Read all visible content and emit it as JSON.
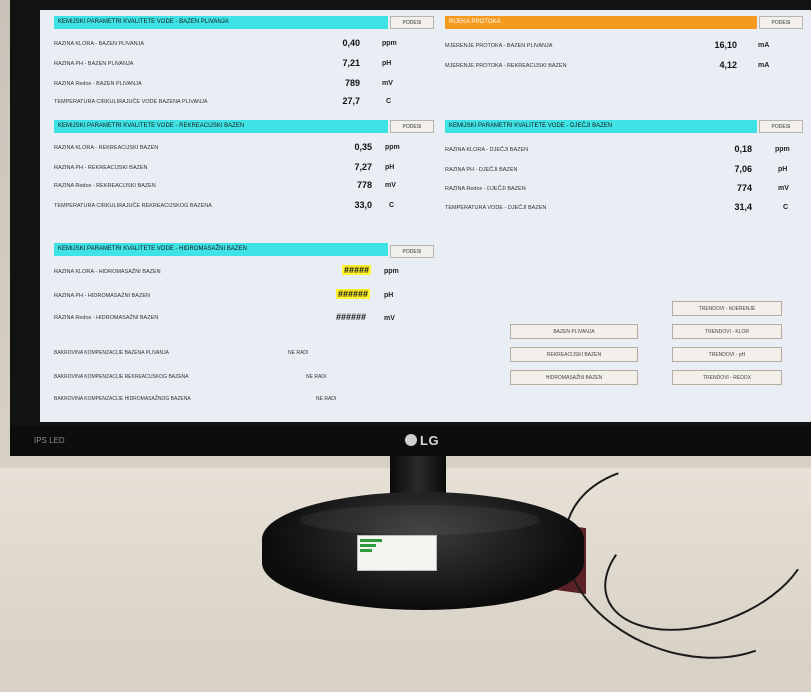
{
  "monitor": {
    "brand": "LG",
    "corner_text": "IPS LED"
  },
  "panel_plivanja": {
    "title": "KEMIJSKI PARAMETRI KVALITETE VODE - BAZEN PLIVANJA",
    "button": "PODESI",
    "rows": [
      {
        "label": "RAZINA KLORA - BAZEN PLIVANJA",
        "value": "0,40",
        "unit": "ppm"
      },
      {
        "label": "RAZINA PH - BAZEN PLIVANJA",
        "value": "7,21",
        "unit": "pH"
      },
      {
        "label": "RAZINA Redox - BAZEN PLIVANJA",
        "value": "789",
        "unit": "mV"
      },
      {
        "label": "TEMPERATURA CIRKULIRAJUĆE VODE BAZENA PLIVANJA",
        "value": "27,7",
        "unit": "C"
      }
    ]
  },
  "panel_protok": {
    "title": "RIJEKA PROTOKA",
    "button": "PODESI",
    "rows": [
      {
        "label": "MJERENJE PROTOKA - BAZEN PLIVANJA",
        "value": "16,10",
        "unit": "mA"
      },
      {
        "label": "MJERENJE PROTOKA - REKREACIJSKI BAZEN",
        "value": "4,12",
        "unit": "mA"
      }
    ]
  },
  "panel_rekreacijski": {
    "title": "KEMIJSKI PARAMETRI KVALITETE VODE - REKREACIJSKI BAZEN",
    "button": "PODESI",
    "rows": [
      {
        "label": "RAZINA KLORA - REKREACIJSKI BAZEN",
        "value": "0,35",
        "unit": "ppm"
      },
      {
        "label": "RAZINA PH - REKREACIJSKI BAZEN",
        "value": "7,27",
        "unit": "pH"
      },
      {
        "label": "RAZINA Redox - REKREACIJSKI BAZEN",
        "value": "778",
        "unit": "mV"
      },
      {
        "label": "TEMPERATURA CIRKULIRAJUĆE REKREACIJSKOG BAZENA",
        "value": "33,0",
        "unit": "C"
      }
    ]
  },
  "panel_djecji": {
    "title": "KEMIJSKI PARAMETRI KVALITETE VODE - DJEČJI BAZEN",
    "button": "PODESI",
    "rows": [
      {
        "label": "RAZINA KLORA - DJEČJI BAZEN",
        "value": "0,18",
        "unit": "ppm"
      },
      {
        "label": "RAZINA PH - DJEČJI BAZEN",
        "value": "7,06",
        "unit": "pH"
      },
      {
        "label": "RAZINA Redox - DJEČJI BAZEN",
        "value": "774",
        "unit": "mV"
      },
      {
        "label": "TEMPERATURA VODE - DJEČJI BAZEN",
        "value": "31,4",
        "unit": "C"
      }
    ]
  },
  "panel_hidromasazni": {
    "title": "KEMIJSKI PARAMETRI KVALITETE VODE - HIDROMASAŽNI BAZEN",
    "button": "PODESI",
    "rows": [
      {
        "label": "RAZINA KLORA - HIDROMASAŽNI BAZEN",
        "value": "#####",
        "unit": "ppm"
      },
      {
        "label": "RAZINA PH - HIDROMASAŽNI BAZEN",
        "value": "######",
        "unit": "pH"
      },
      {
        "label": "RAZINA Redox - HIDROMASAŽNI BAZEN",
        "value": "######",
        "unit": "mV"
      }
    ]
  },
  "kompenzacija": [
    {
      "label": "BAKROVINA KOMPENZACIJE BAZENA PLIVANJA",
      "status": "NE RADI"
    },
    {
      "label": "BAKROVINA KOMPENZACIJE REKREACIJSKOG BAZENA",
      "status": "NE RADI"
    },
    {
      "label": "BAKROVINA KOMPENZACIJE HIDROMASAŽNOG BAZENA",
      "status": "NE RADI"
    }
  ],
  "nav_buttons": {
    "bazen_plivanja": "BAZEN PLIVANJA",
    "rekreacijski": "REKREACIJSKI BAZEN",
    "hidromasazni": "HIDROMASAŽNI BAZEN",
    "trend_mjerenje": "TRENDOVI - MJERENJE",
    "trend_klor": "TRENDOVI - KLOR",
    "trend_ph": "TRENDOVI - pH",
    "trend_redox": "TRENDOVI - REDOX"
  },
  "colors": {
    "header_cyan": "#3fe3e6",
    "header_orange": "#f59a1e",
    "highlight_yellow": "#fff22e"
  }
}
